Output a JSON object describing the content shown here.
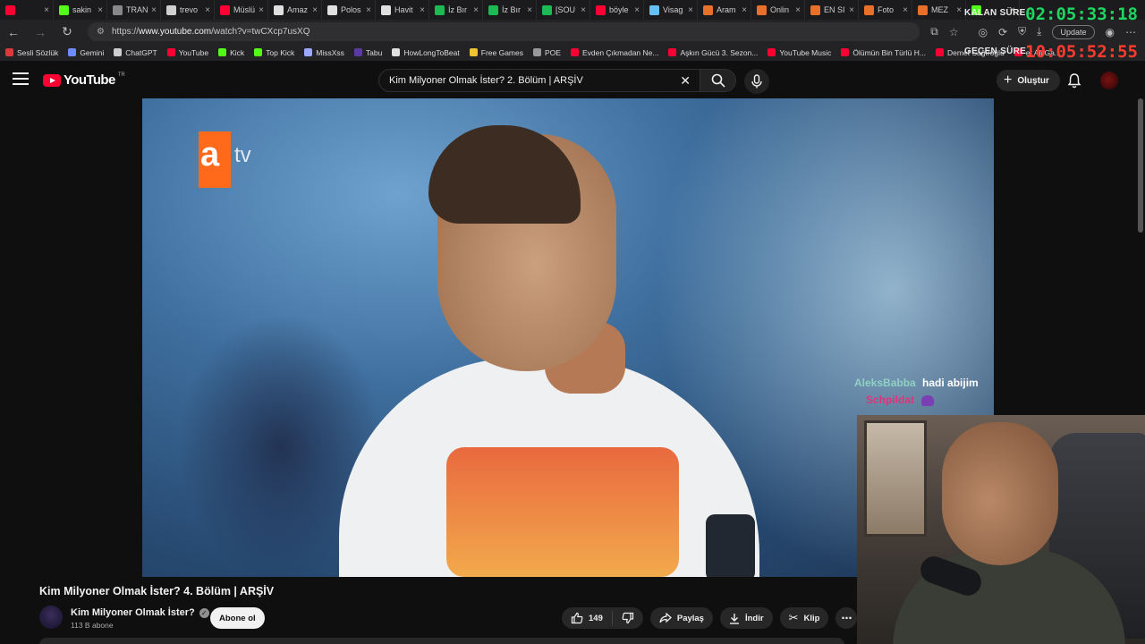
{
  "browser": {
    "tabs": [
      {
        "title": "",
        "color": "#ff0033"
      },
      {
        "title": "sakin",
        "color": "#53fc18"
      },
      {
        "title": "TRAN",
        "color": "#888888"
      },
      {
        "title": "trevo",
        "color": "#d0d0d0"
      },
      {
        "title": "Müslü",
        "color": "#ff0033"
      },
      {
        "title": "Amaz",
        "color": "#e0e0e0"
      },
      {
        "title": "Polos",
        "color": "#e0e0e0"
      },
      {
        "title": "Havit",
        "color": "#e0e0e0"
      },
      {
        "title": "İz Bır",
        "color": "#1db954"
      },
      {
        "title": "İz Bır",
        "color": "#1db954"
      },
      {
        "title": "[SOU",
        "color": "#1db954"
      },
      {
        "title": "böyle",
        "color": "#ff0033"
      },
      {
        "title": "Visag",
        "color": "#66c0f4"
      },
      {
        "title": "Aram",
        "color": "#e8702a"
      },
      {
        "title": "Onlin",
        "color": "#e8702a"
      },
      {
        "title": "EN SI",
        "color": "#e8702a"
      },
      {
        "title": "Foto",
        "color": "#e8702a"
      },
      {
        "title": "MEZ",
        "color": "#e8702a"
      },
      {
        "title": "",
        "color": "#53fc18"
      }
    ],
    "url_prefix": "https://",
    "url_host": "www.youtube.com",
    "url_path": "/watch?v=twCXcp7usXQ",
    "update_label": "Update",
    "bookmarks": [
      {
        "label": "Sesli Sözlük",
        "color": "#d93a3a"
      },
      {
        "label": "Gemini",
        "color": "#6f8cff"
      },
      {
        "label": "ChatGPT",
        "color": "#cfcfcf"
      },
      {
        "label": "YouTube",
        "color": "#ff0033"
      },
      {
        "label": "Kick",
        "color": "#53fc18"
      },
      {
        "label": "Top Kick",
        "color": "#53fc18"
      },
      {
        "label": "MissXss",
        "color": "#9aa8ff"
      },
      {
        "label": "Tabu",
        "color": "#5a3aa0"
      },
      {
        "label": "HowLongToBeat",
        "color": "#e0e0e0"
      },
      {
        "label": "Free Games",
        "color": "#f2c230"
      },
      {
        "label": "POE",
        "color": "#999999"
      },
      {
        "label": "Evden Çıkmadan Ne...",
        "color": "#ff0033"
      },
      {
        "label": "Aşkın Gücü 3. Sezon...",
        "color": "#ff0033"
      },
      {
        "label": "YouTube Music",
        "color": "#ff0033"
      },
      {
        "label": "Ölümün Bin Türlü H...",
        "color": "#ff0033"
      },
      {
        "label": "Demet Sağıroğlu",
        "color": "#ff0033"
      },
      {
        "label": "et Ali Ga...",
        "color": "#ff0033"
      }
    ]
  },
  "timer": {
    "remaining_label": "KALAN SÜRE",
    "remaining_value": "02:05:33:18",
    "remaining_color": "#1ed760",
    "elapsed_label": "GEÇEN SÜRE",
    "elapsed_value": "10:05:52:55",
    "elapsed_color": "#ff3b30"
  },
  "youtube": {
    "logo_text": "YouTube",
    "country_code": "TR",
    "search_query": "Kim Milyoner Olmak İster? 2. Bölüm | ARŞİV",
    "create_label": "Oluştur",
    "video_channel_logo_letter": "a",
    "video_channel_logo_suffix": "tv",
    "video_title": "Kim Milyoner Olmak İster? 4. Bölüm | ARŞİV",
    "channel_name": "Kim Milyoner Olmak İster?",
    "subscribers": "113 B abone",
    "subscribe_label": "Abone ol",
    "like_count": "149",
    "share_label": "Paylaş",
    "download_label": "İndir",
    "clip_label": "Klip"
  },
  "chat": {
    "messages": [
      {
        "user": "AleksBabba",
        "user_color": "#8fd0c4",
        "text": "hadi abijim"
      },
      {
        "user": "Schpildat",
        "user_color": "#e0337a",
        "text": ""
      }
    ]
  }
}
